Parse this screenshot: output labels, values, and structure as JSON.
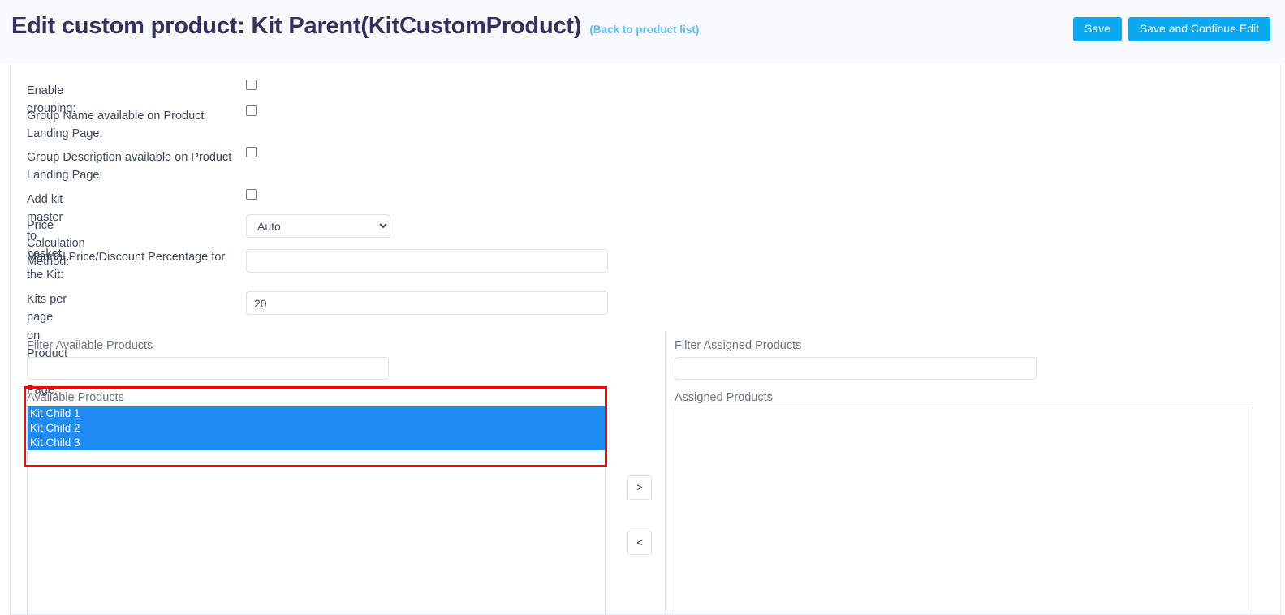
{
  "header": {
    "title": "Edit custom product: Kit Parent(KitCustomProduct)",
    "back_link": "(Back to product list)",
    "save_label": "Save",
    "save_continue_label": "Save and Continue Edit",
    "button_color": "#0ca9ee",
    "link_color": "#5bc0f8"
  },
  "form": {
    "rows": [
      {
        "label": "Enable grouping:",
        "type": "checkbox",
        "checked": false
      },
      {
        "label": "Group Name available on Product\nLanding Page:",
        "type": "checkbox",
        "checked": false
      },
      {
        "label": "Group Description available on Product\nLanding Page:",
        "type": "checkbox",
        "checked": false
      },
      {
        "label": "Add kit master to basket:",
        "type": "checkbox",
        "checked": false
      },
      {
        "label": "Price Calculation Method:",
        "type": "select",
        "value": "Auto",
        "options": [
          "Auto"
        ]
      },
      {
        "label": "Manual Price/Discount Percentage for\nthe Kit:",
        "type": "text",
        "value": "",
        "placeholder": ""
      },
      {
        "label": "Kits per page on Product Landing Page:",
        "type": "text",
        "value": "20",
        "placeholder": ""
      }
    ]
  },
  "dual_list": {
    "available": {
      "filter_label": "Filter Available Products",
      "filter_value": "",
      "filter_placeholder": "",
      "list_caption": "Available Products",
      "items": [
        {
          "label": "Kit Child 1",
          "selected": true
        },
        {
          "label": "Kit Child 2",
          "selected": true
        },
        {
          "label": "Kit Child 3",
          "selected": true
        }
      ],
      "selection_color": "#1f8cf5",
      "highlight_color": "#fb0007"
    },
    "assigned": {
      "filter_label": "Filter Assigned Products",
      "filter_value": "",
      "filter_placeholder": "",
      "list_caption": "Assigned Products",
      "items": []
    },
    "move_right_label": ">",
    "move_left_label": "<"
  }
}
